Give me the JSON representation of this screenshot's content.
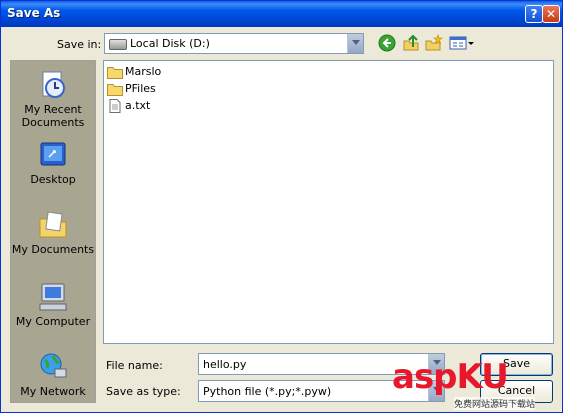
{
  "window": {
    "title": "Save As",
    "help_button": "?",
    "close_button": "✕"
  },
  "save_in": {
    "label": "Save in:",
    "value": "Local Disk (D:)"
  },
  "places": [
    {
      "label": "My Recent Documents"
    },
    {
      "label": "Desktop"
    },
    {
      "label": "My Documents"
    },
    {
      "label": "My Computer"
    },
    {
      "label": "My Network"
    }
  ],
  "files": [
    {
      "name": "Marslo",
      "type": "folder"
    },
    {
      "name": "PFiles",
      "type": "folder"
    },
    {
      "name": "a.txt",
      "type": "text-file"
    }
  ],
  "file_name": {
    "label": "File name:",
    "value": "hello.py"
  },
  "save_as_type": {
    "label": "Save as type:",
    "value": "Python file (*.py;*.pyw)"
  },
  "buttons": {
    "save": "Save",
    "cancel": "Cancel"
  },
  "watermark": {
    "brand": "aspKU",
    "sub": "免费网站源码下载站"
  },
  "colors": {
    "titlebar": "#0054e3",
    "face": "#ece9d8",
    "places_bar": "#a8a591",
    "accent_red": "#e8182c"
  }
}
